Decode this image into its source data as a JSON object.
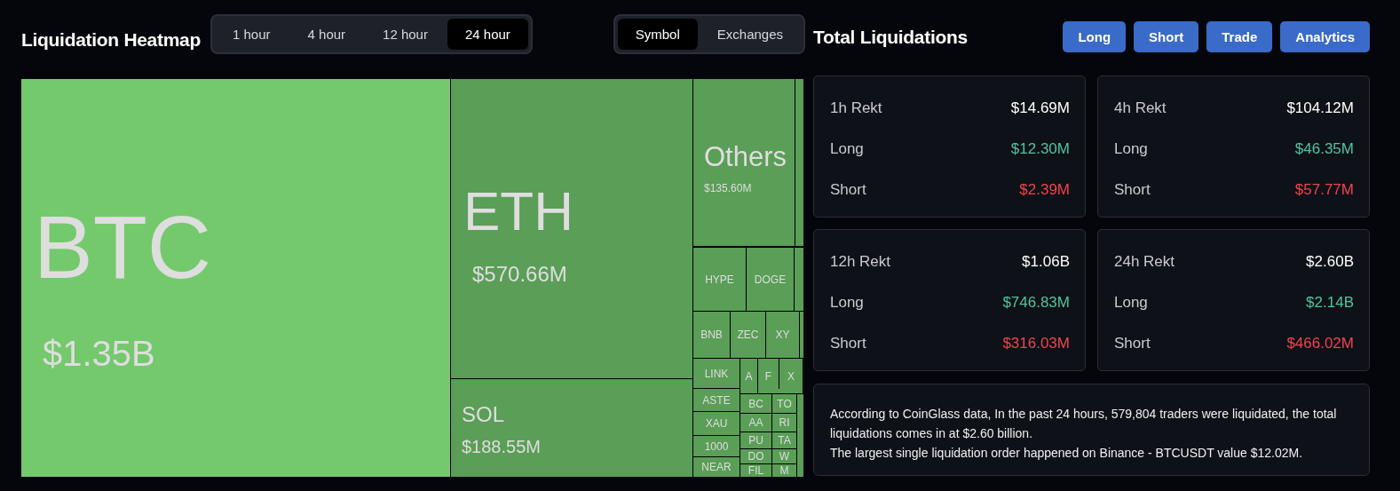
{
  "heatmap": {
    "title": "Liquidation Heatmap",
    "periods": [
      {
        "label": "1 hour",
        "selected": false
      },
      {
        "label": "4 hour",
        "selected": false
      },
      {
        "label": "12 hour",
        "selected": false
      },
      {
        "label": "24 hour",
        "selected": true
      }
    ],
    "groupings": [
      {
        "label": "Symbol",
        "selected": true
      },
      {
        "label": "Exchanges",
        "selected": false
      }
    ],
    "tiles": [
      {
        "label": "BTC",
        "value": "$1.35B",
        "color": "#74c96d"
      },
      {
        "label": "ETH",
        "value": "$570.66M",
        "color": "#5a9e57"
      },
      {
        "label": "SOL",
        "value": "$188.55M",
        "color": "#5a9e57"
      },
      {
        "label": "Others",
        "value": "$135.60M",
        "color": "#5a9e57"
      },
      {
        "label": "HYPE",
        "color": "#5a9e57"
      },
      {
        "label": "DOGE",
        "color": "#5a9e57"
      },
      {
        "label": "BNB",
        "color": "#5a9e57"
      },
      {
        "label": "ZEC",
        "color": "#5a9e57"
      },
      {
        "label": "XY",
        "color": "#5a9e57"
      },
      {
        "label": "LINK",
        "color": "#5a9e57"
      },
      {
        "label": "A",
        "color": "#5a9e57"
      },
      {
        "label": "F",
        "color": "#5a9e57"
      },
      {
        "label": "X",
        "color": "#5a9e57"
      },
      {
        "label": "ASTE",
        "color": "#5a9e57"
      },
      {
        "label": "XAU",
        "color": "#5a9e57"
      },
      {
        "label": "1000",
        "color": "#5a9e57"
      },
      {
        "label": "NEAR",
        "color": "#5a9e57"
      },
      {
        "label": "BC",
        "color": "#5a9e57"
      },
      {
        "label": "TO",
        "color": "#5a9e57"
      },
      {
        "label": "AA",
        "color": "#5a9e57"
      },
      {
        "label": "RI",
        "color": "#5a9e57"
      },
      {
        "label": "PU",
        "color": "#5a9e57"
      },
      {
        "label": "TA",
        "color": "#5a9e57"
      },
      {
        "label": "DO",
        "color": "#5a9e57"
      },
      {
        "label": "W",
        "color": "#5a9e57"
      },
      {
        "label": "FIL",
        "color": "#5a9e57"
      },
      {
        "label": "M",
        "color": "#5a9e57"
      }
    ]
  },
  "totals": {
    "title": "Total Liquidations",
    "buttons": [
      "Long",
      "Short",
      "Trade",
      "Analytics"
    ],
    "cards": [
      {
        "title": "1h Rekt",
        "total": "$14.69M",
        "long_label": "Long",
        "long": "$12.30M",
        "short_label": "Short",
        "short": "$2.39M"
      },
      {
        "title": "4h Rekt",
        "total": "$104.12M",
        "long_label": "Long",
        "long": "$46.35M",
        "short_label": "Short",
        "short": "$57.77M"
      },
      {
        "title": "12h Rekt",
        "total": "$1.06B",
        "long_label": "Long",
        "long": "$746.83M",
        "short_label": "Short",
        "short": "$316.03M"
      },
      {
        "title": "24h Rekt",
        "total": "$2.60B",
        "long_label": "Long",
        "long": "$2.14B",
        "short_label": "Short",
        "short": "$466.02M"
      }
    ],
    "summary": [
      "According to CoinGlass data, In the past 24 hours, 579,804 traders were liquidated, the total liquidations comes in at $2.60 billion.",
      "The largest single liquidation order happened on Binance - BTCUSDT value $12.02M."
    ]
  }
}
